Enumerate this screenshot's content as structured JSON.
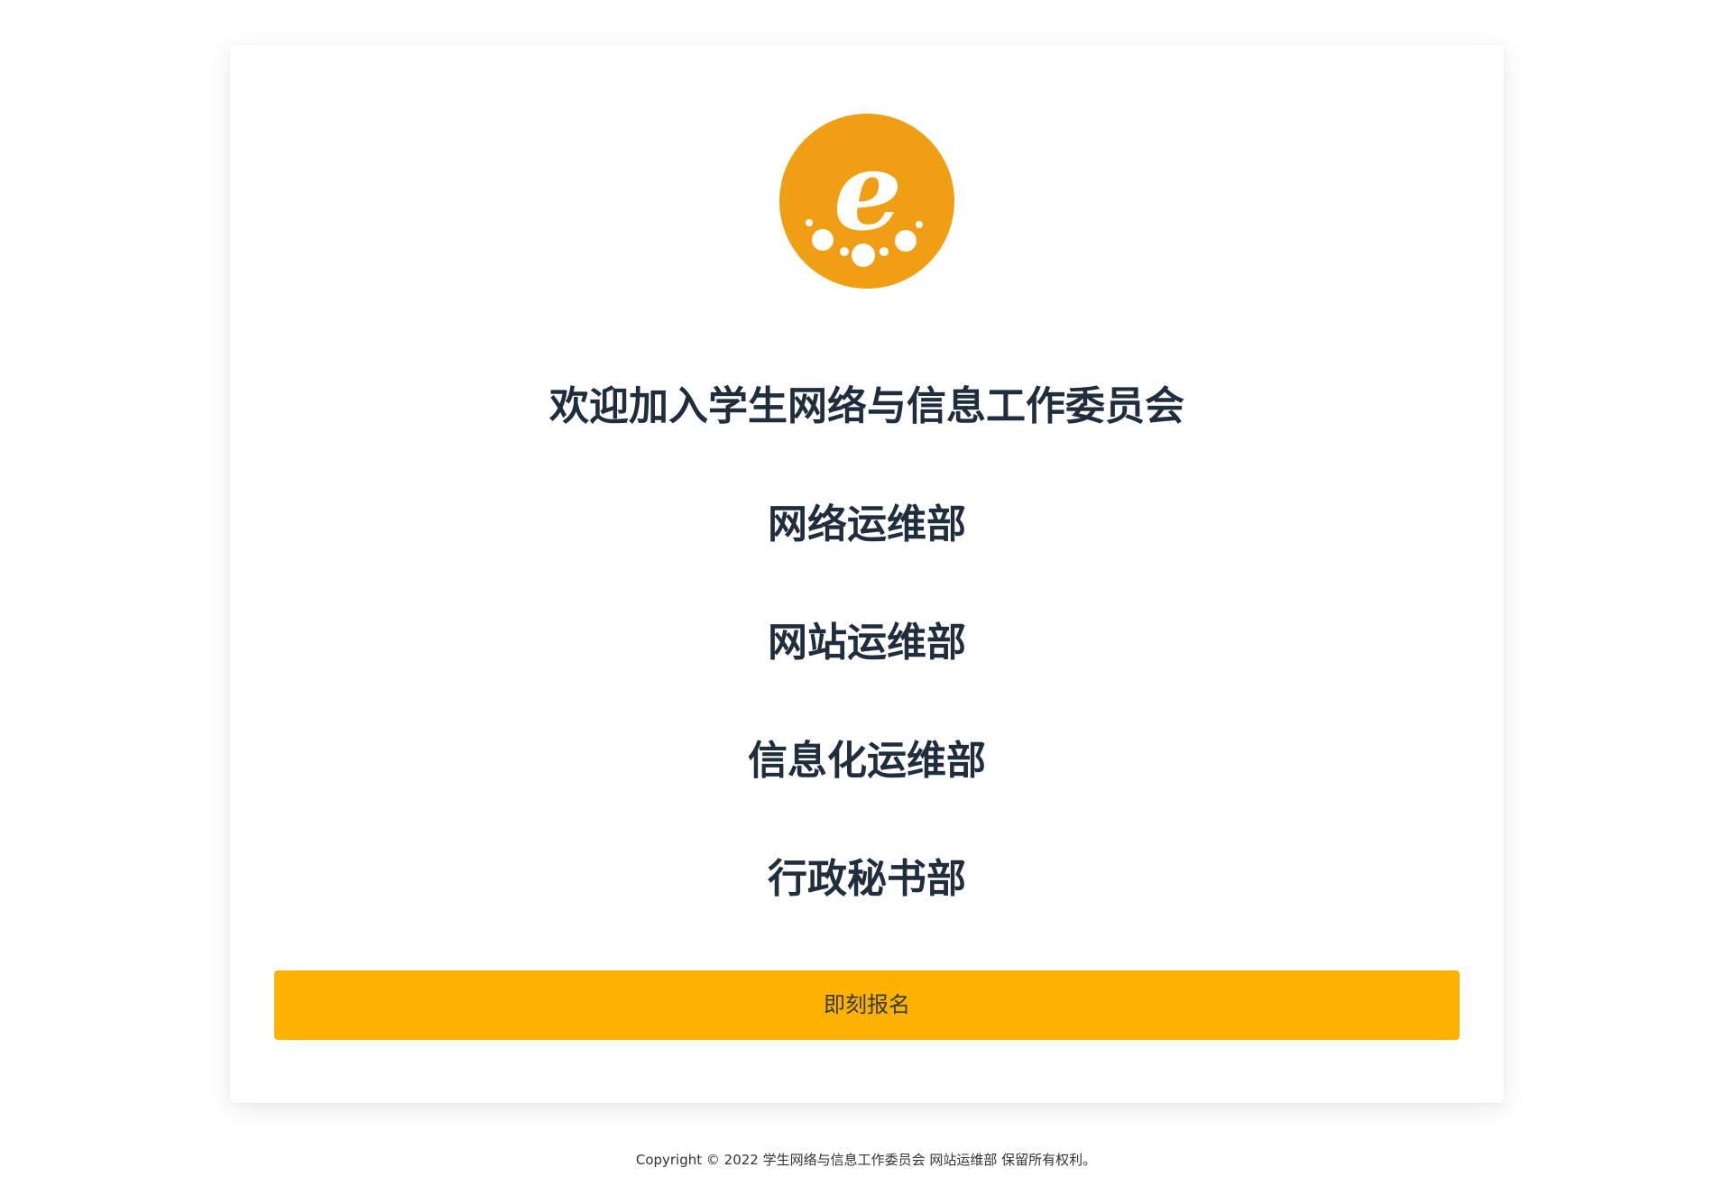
{
  "logo": {
    "icon": "e-logo-icon",
    "letter": "e",
    "color": "#f09e13"
  },
  "main": {
    "title": "欢迎加入学生网络与信息工作委员会",
    "departments": [
      "网络运维部",
      "网站运维部",
      "信息化运维部",
      "行政秘书部"
    ],
    "signup_label": "即刻报名",
    "signup_color": "#fdb100"
  },
  "footer": {
    "copyright": "Copyright © 2022 学生网络与信息工作委员会 网站运维部 保留所有权利。"
  }
}
